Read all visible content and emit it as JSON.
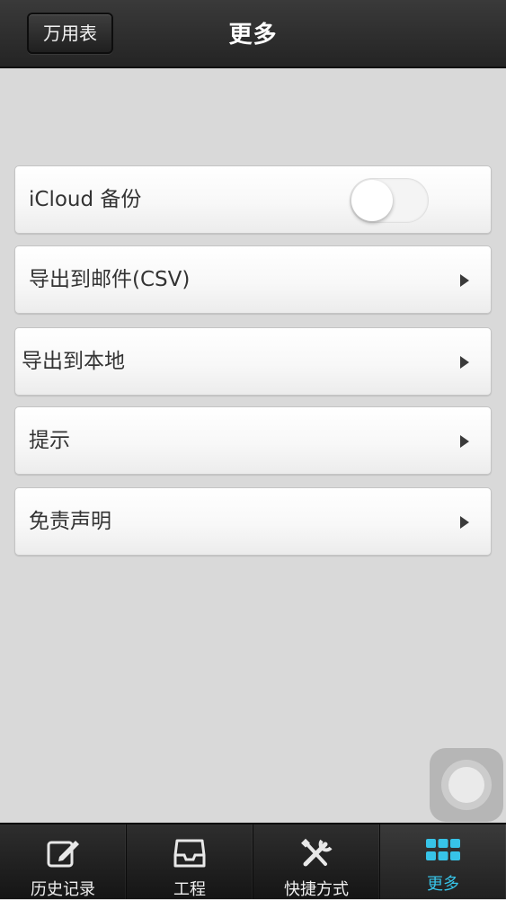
{
  "header": {
    "back_label": "万用表",
    "title": "更多"
  },
  "settings": {
    "icloud_label": "iCloud 备份",
    "icloud_enabled": false,
    "items": [
      {
        "label": "导出到邮件(CSV)",
        "icon": "chevron-right-icon"
      },
      {
        "label": "导出到本地",
        "icon": "chevron-right-icon"
      },
      {
        "label": "提示",
        "icon": "chevron-right-icon"
      },
      {
        "label": "免责声明",
        "icon": "chevron-right-icon"
      }
    ]
  },
  "tabbar": {
    "active": "更多",
    "active_color": "#37c4e8",
    "tabs": [
      {
        "label": "历史记录",
        "icon": "edit-icon"
      },
      {
        "label": "工程",
        "icon": "inbox-icon"
      },
      {
        "label": "快捷方式",
        "icon": "tools-icon"
      },
      {
        "label": "更多",
        "icon": "grid-icon"
      }
    ]
  }
}
